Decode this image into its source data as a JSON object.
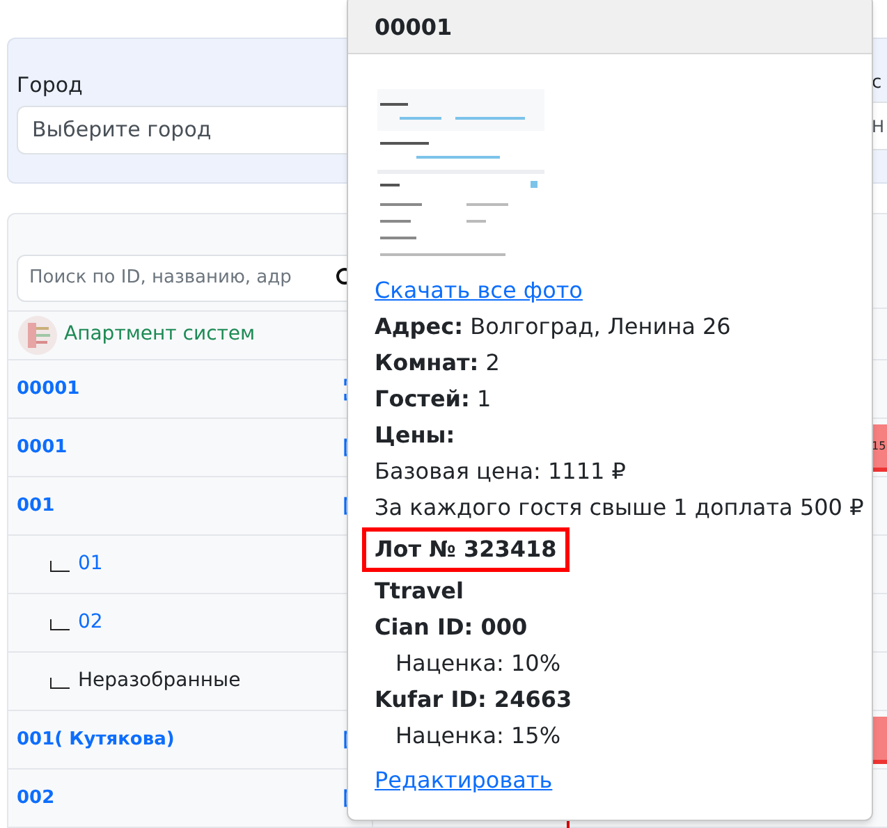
{
  "filters": {
    "city": {
      "label": "Город",
      "placeholder": "Выберите город"
    },
    "next_label": "с",
    "next_value": "Н"
  },
  "search": {
    "placeholder": "Поиск по ID, названию, адр"
  },
  "company": {
    "name": "Апартмент систем"
  },
  "rows": [
    {
      "label": "00001",
      "kind": "current",
      "booked": false
    },
    {
      "label": "0001",
      "kind": "object",
      "booked": true,
      "booking_label": "15"
    },
    {
      "label": "001",
      "kind": "object",
      "booked": false
    },
    {
      "label": "01",
      "kind": "child",
      "booked": false
    },
    {
      "label": "02",
      "kind": "child",
      "booked": false
    },
    {
      "label": "Неразобранные",
      "kind": "unsorted",
      "booked": false
    },
    {
      "label": "001( Кутякова)",
      "kind": "object",
      "booked": true
    },
    {
      "label": "002",
      "kind": "object",
      "booked": false
    }
  ],
  "popover": {
    "title": "00001",
    "download_link": "Скачать все фото",
    "lines": [
      {
        "kind": "text",
        "text": "**Адрес:** Волгоград, Ленина 26"
      },
      {
        "kind": "text",
        "text": "**Комнат:** 2"
      },
      {
        "kind": "text",
        "text": "**Гостей:** 1"
      },
      {
        "kind": "heading",
        "text": "Цены:"
      },
      {
        "kind": "text",
        "text": "Базовая цена: 1111 ₽"
      },
      {
        "kind": "text",
        "text": "За каждого гостя свыше 1 доплата 500 ₽"
      },
      {
        "kind": "heading",
        "text": "Лот № 323418",
        "highlighted": true
      },
      {
        "kind": "heading",
        "text": "Ttravel"
      },
      {
        "kind": "heading",
        "text": "Cian ID: 000"
      },
      {
        "kind": "indent",
        "text": "Наценка: 10%"
      },
      {
        "kind": "heading",
        "text": "Kufar ID: 24663"
      },
      {
        "kind": "indent",
        "text": "Наценка: 15%"
      }
    ],
    "edit_link": "Редактировать"
  }
}
